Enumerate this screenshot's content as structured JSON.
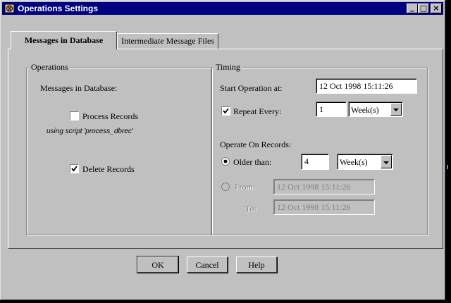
{
  "window": {
    "title": "Operations Settings",
    "minimize_glyph": "_",
    "maximize_glyph": "□",
    "close_glyph": "×",
    "title_color": "#000080",
    "face_color": "#c0c0c0"
  },
  "tabs": [
    {
      "label": "Messages in Database",
      "active": true
    },
    {
      "label": "Intermediate Message Files",
      "active": false
    }
  ],
  "operations": {
    "group_label": "Operations",
    "heading": "Messages in Database:",
    "process_records": {
      "label": "Process Records",
      "checked": false
    },
    "script_note": "using script 'process_dbrec'",
    "delete_records": {
      "label": "Delete Records",
      "checked": true
    }
  },
  "timing": {
    "group_label": "Timing",
    "start_label": "Start Operation at:",
    "start_value": "12 Oct 1998 15:11:26",
    "repeat": {
      "label": "Repeat Every:",
      "checked": true,
      "value": "1",
      "unit": "Week(s)"
    },
    "operate_label": "Operate On Records:",
    "older_than": {
      "label": "Older than:",
      "selected": true,
      "value": "4",
      "unit": "Week(s)"
    },
    "from": {
      "label": "From:",
      "selected": false,
      "value": "12 Oct 1998 15:11:26"
    },
    "to": {
      "label": "To:",
      "value": "12 Oct 1998 15:11:26"
    }
  },
  "buttons": {
    "ok": "OK",
    "cancel": "Cancel",
    "help": "Help"
  }
}
